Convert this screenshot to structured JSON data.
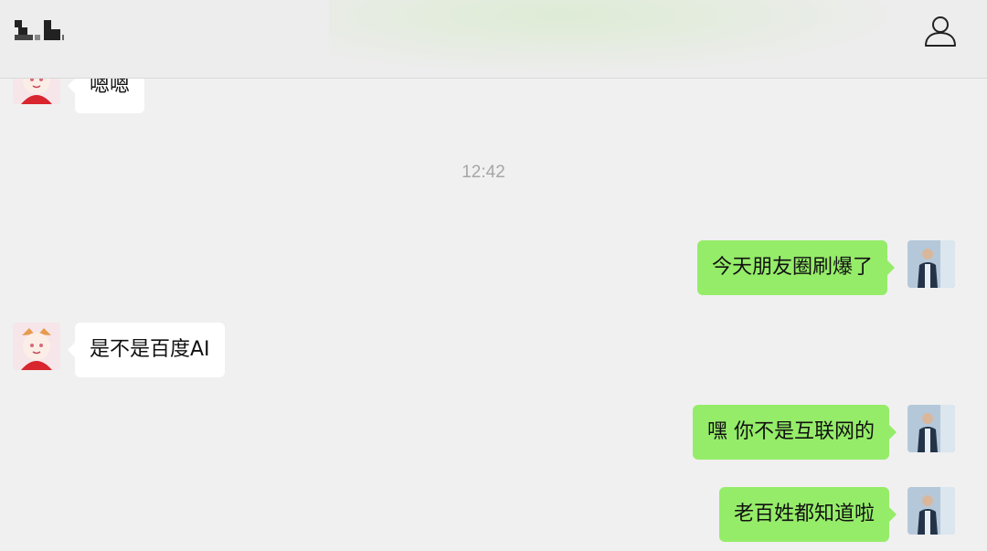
{
  "header": {
    "title": "",
    "profile_icon": "person-icon"
  },
  "messages": [
    {
      "side": "left",
      "text": "嗯嗯"
    },
    {
      "type": "time",
      "text": "12:42"
    },
    {
      "side": "right",
      "text": "今天朋友圈刷爆了"
    },
    {
      "side": "left",
      "text": "是不是百度AI"
    },
    {
      "side": "right",
      "text": "嘿 你不是互联网的"
    },
    {
      "side": "right",
      "text": "老百姓都知道啦"
    }
  ],
  "colors": {
    "background": "#f0f0f0",
    "incoming_bubble": "#ffffff",
    "outgoing_bubble": "#95ec69",
    "timestamp": "#a6a6a6"
  }
}
